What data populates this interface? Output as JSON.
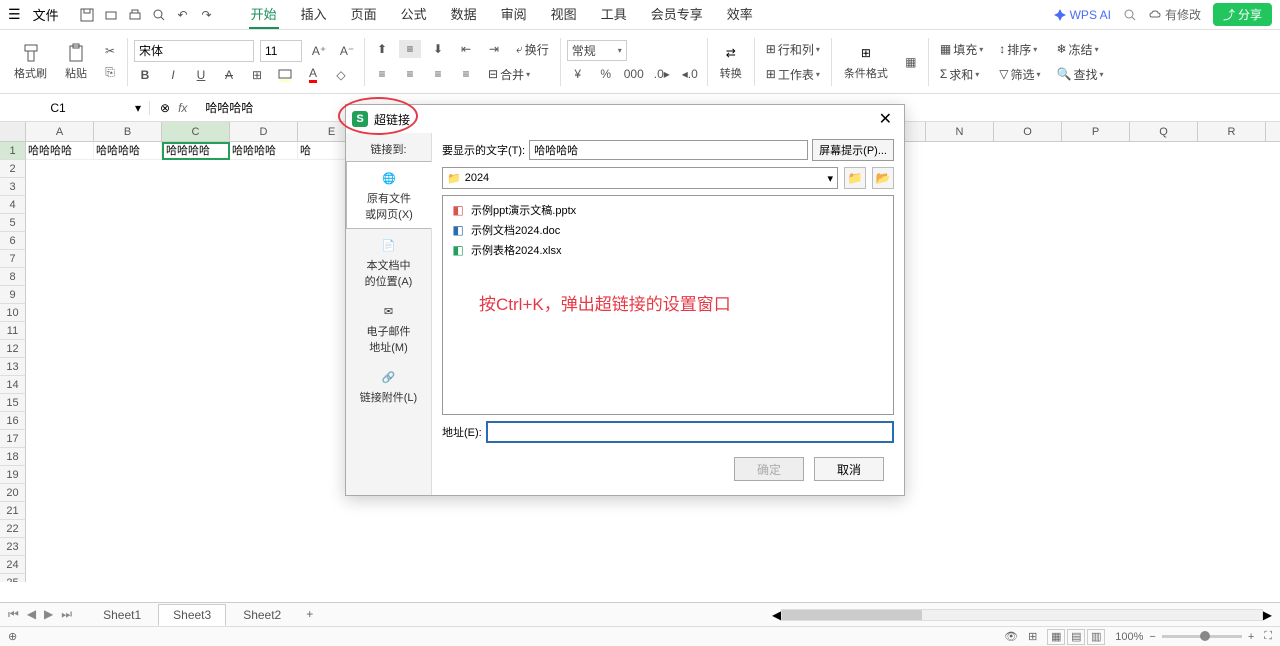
{
  "menu": {
    "file": "文件",
    "tabs": [
      "开始",
      "插入",
      "页面",
      "公式",
      "数据",
      "审阅",
      "视图",
      "工具",
      "会员专享",
      "效率"
    ],
    "active_tab": 0,
    "wps_ai": "WPS AI",
    "status": "有修改",
    "share": "分享"
  },
  "ribbon": {
    "format_painter": "格式刷",
    "paste": "粘贴",
    "font_name": "宋体",
    "font_size": "11",
    "wrap": "换行",
    "merge": "合并",
    "general": "常规",
    "convert": "转换",
    "row_col": "行和列",
    "worksheet": "工作表",
    "cond_format": "条件格式",
    "fill": "填充",
    "sort": "排序",
    "sum": "求和",
    "filter": "筛选",
    "freeze": "冻结",
    "find": "查找"
  },
  "formula_bar": {
    "cell_ref": "C1",
    "formula": "哈哈哈哈"
  },
  "grid": {
    "columns": [
      "A",
      "B",
      "C",
      "D",
      "E",
      "",
      "",
      "",
      "",
      "",
      "",
      "",
      "N",
      "O",
      "P",
      "Q",
      "R"
    ],
    "row1": [
      "哈哈哈哈",
      "哈哈哈哈",
      "哈哈哈哈",
      "哈哈哈哈",
      "哈"
    ],
    "selected_cell": "C1"
  },
  "dialog": {
    "title": "超链接",
    "link_to": "链接到:",
    "display_text_label": "要显示的文字(T):",
    "display_text_value": "哈哈哈哈",
    "screentip": "屏幕提示(P)...",
    "sidebar": [
      {
        "label": "原有文件\n或网页(X)",
        "active": true
      },
      {
        "label": "本文档中\n的位置(A)"
      },
      {
        "label": "电子邮件\n地址(M)"
      },
      {
        "label": "链接附件(L)"
      }
    ],
    "folder": "2024",
    "files": [
      {
        "icon": "pptx",
        "name": "示例ppt演示文稿.pptx"
      },
      {
        "icon": "doc",
        "name": "示例文档2024.doc"
      },
      {
        "icon": "xlsx",
        "name": "示例表格2024.xlsx"
      }
    ],
    "annotation": "按Ctrl+K，弹出超链接的设置窗口",
    "address_label": "地址(E):",
    "ok": "确定",
    "cancel": "取消"
  },
  "sheets": {
    "tabs": [
      "Sheet1",
      "Sheet3",
      "Sheet2"
    ],
    "active": 1
  },
  "status": {
    "zoom": "100%"
  }
}
